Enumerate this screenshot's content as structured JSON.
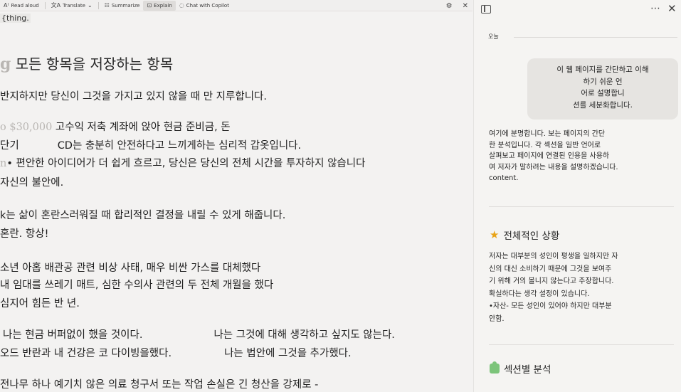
{
  "toolbar": {
    "read_aloud": "Read aloud",
    "translate": "Translate",
    "summarize": "Summarize",
    "explain": "Explain",
    "chat": "Chat with Copilot"
  },
  "article": {
    "snippet": "{thing.",
    "heading_faded": "g",
    "heading": "모든 항목을 저장하는 항목",
    "lines": [
      "반지하지만 당신이 그것을 가지고 있지 않을 때 만 지루합니다.",
      "고수익 저축 계좌에 앉아 현금 준비금, 돈",
      "단기",
      "CD는 충분히 안전하다고 느끼게하는 심리적 갑옷입니다.",
      "• 편안한 아이디어가 더 쉽게 흐르고, 당신은 당신의 전체 시간을 투자하지 않습니다",
      "자신의 불안에.",
      "k는 삶이 혼란스러워질 때 합리적인 결정을 내릴 수 있게 해줍니다.",
      "혼란. 항상!",
      "소년 아홉 배관공 관련 비상 사태, 매우 비싼 가스를 대체했다",
      "내 임대를 쓰레기 매트, 심한 수의사 관련의 두 전체 개월을 했다",
      "심지어 힘든 반 년.",
      "나는 현금 버퍼없이 했을 것이다.",
      "나는 그것에 대해 생각하고 싶지도 않는다.",
      "오드 반란과 내 건강은 코 다이빙을했다.",
      "나는 법안에 그것을 추가했다.",
      "전나무 하나 예기치 않은 의료 청구서 또는 작업 손실은 긴 청산을 강제로 -"
    ],
    "faded_amount": "o $30,000",
    "faded_marker": "n"
  },
  "sidebar": {
    "date": "오늘",
    "user_message": "이 웹 페이지를 간단하고 이해\n하기 쉬운 언\n어로 설명합니\n션를 세분화합니다.",
    "reply": "여기에 분명합니다. 보는 페이지의 간단\n한 분석입니다. 각 섹션을 일반 언어로\n살펴보고 페이지에 연결된 인용을 사용하\n여 저자가 말하려는 내용을 설명하겠습니다.\ncontent.",
    "section1_title": "전체적인 상황",
    "section1_body": "저자는 대부분의 성인이 평생을 일하지만 자\n신의 대신 소비하기 때문에 그것을 보여주\n기 위해 거의 볼니지 않는다고 주장합니다.\n확실하다는 생각 설정이 있습니다.\n•자산- 모든 성인이 있어야 하지만 대부분\n안함.",
    "section2_title": "섹션별 분석"
  }
}
